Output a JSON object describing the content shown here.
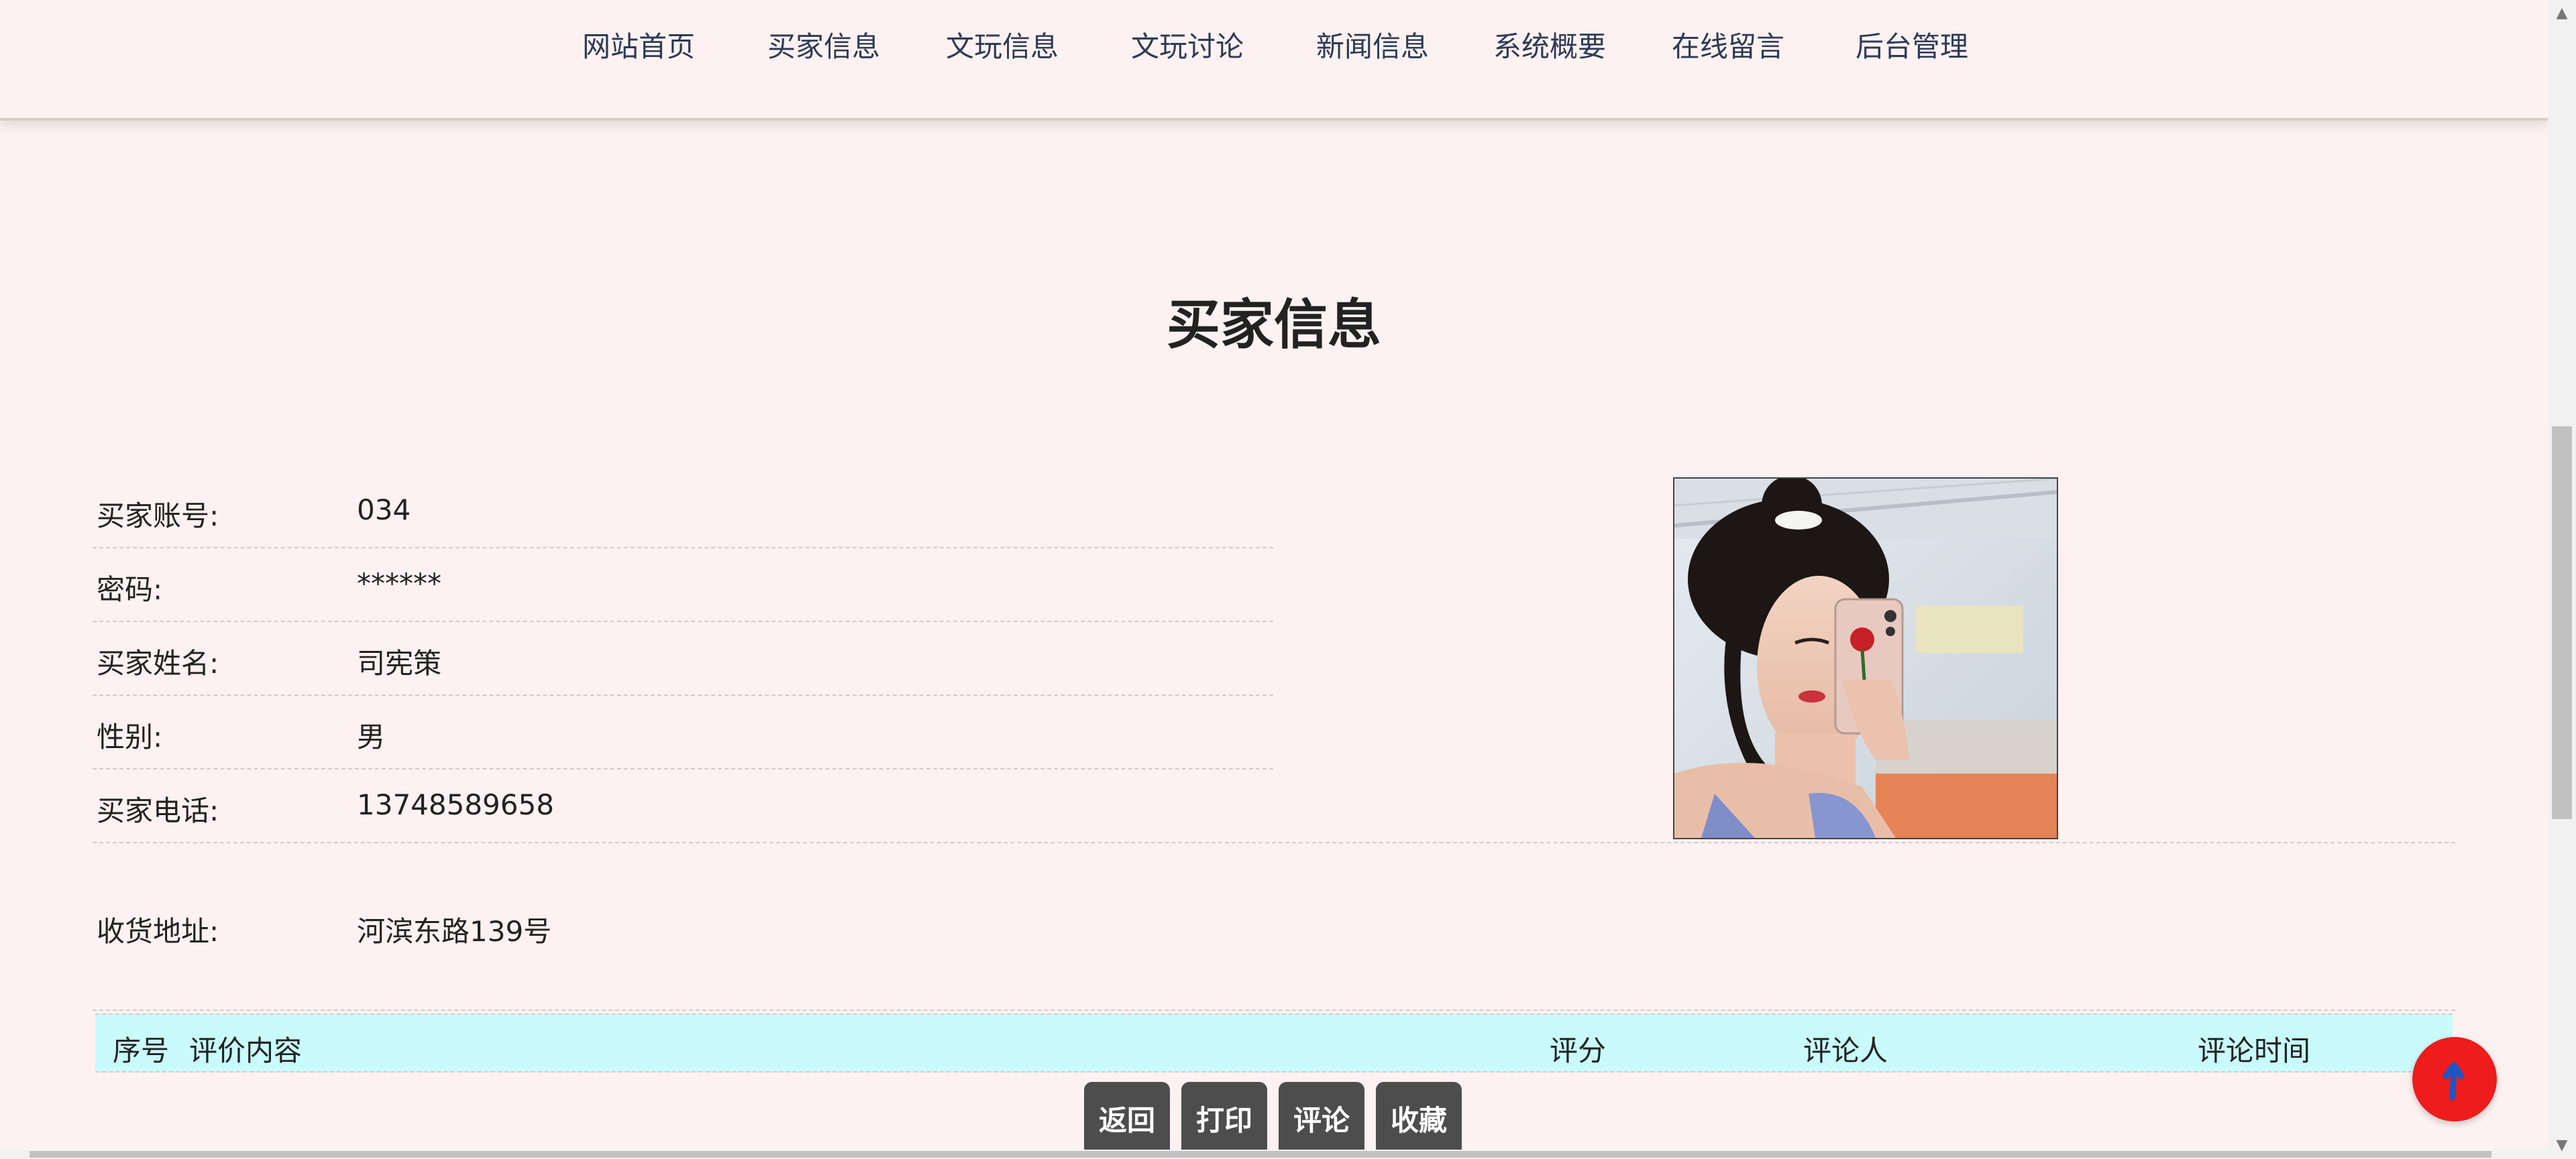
{
  "nav": {
    "items": [
      "网站首页",
      "买家信息",
      "文玩信息",
      "文玩讨论",
      "新闻信息",
      "系统概要",
      "在线留言",
      "后台管理"
    ]
  },
  "page": {
    "title": "买家信息"
  },
  "details": [
    {
      "label": "买家账号:",
      "value": "034"
    },
    {
      "label": "密码:",
      "value": "******"
    },
    {
      "label": "买家姓名:",
      "value": "司宪策"
    },
    {
      "label": "性别:",
      "value": "男"
    },
    {
      "label": "买家电话:",
      "value": "13748589658"
    },
    {
      "label": "收货地址:",
      "value": "河滨东路139号"
    }
  ],
  "comments_table": {
    "columns": [
      "序号",
      "评价内容",
      "评分",
      "评论人",
      "评论时间"
    ],
    "rows": []
  },
  "actions": {
    "back": "返回",
    "print": "打印",
    "comment": "评论",
    "favorite": "收藏"
  },
  "colors": {
    "page_bg": "#fdf2f1",
    "nav_text": "#2d3a55",
    "table_header_bg": "#c9fbfc",
    "button_bg": "#4d4d4d",
    "to_top_bg": "#ee1c1c"
  },
  "icons": {
    "to_top": "arrow-up-icon"
  }
}
